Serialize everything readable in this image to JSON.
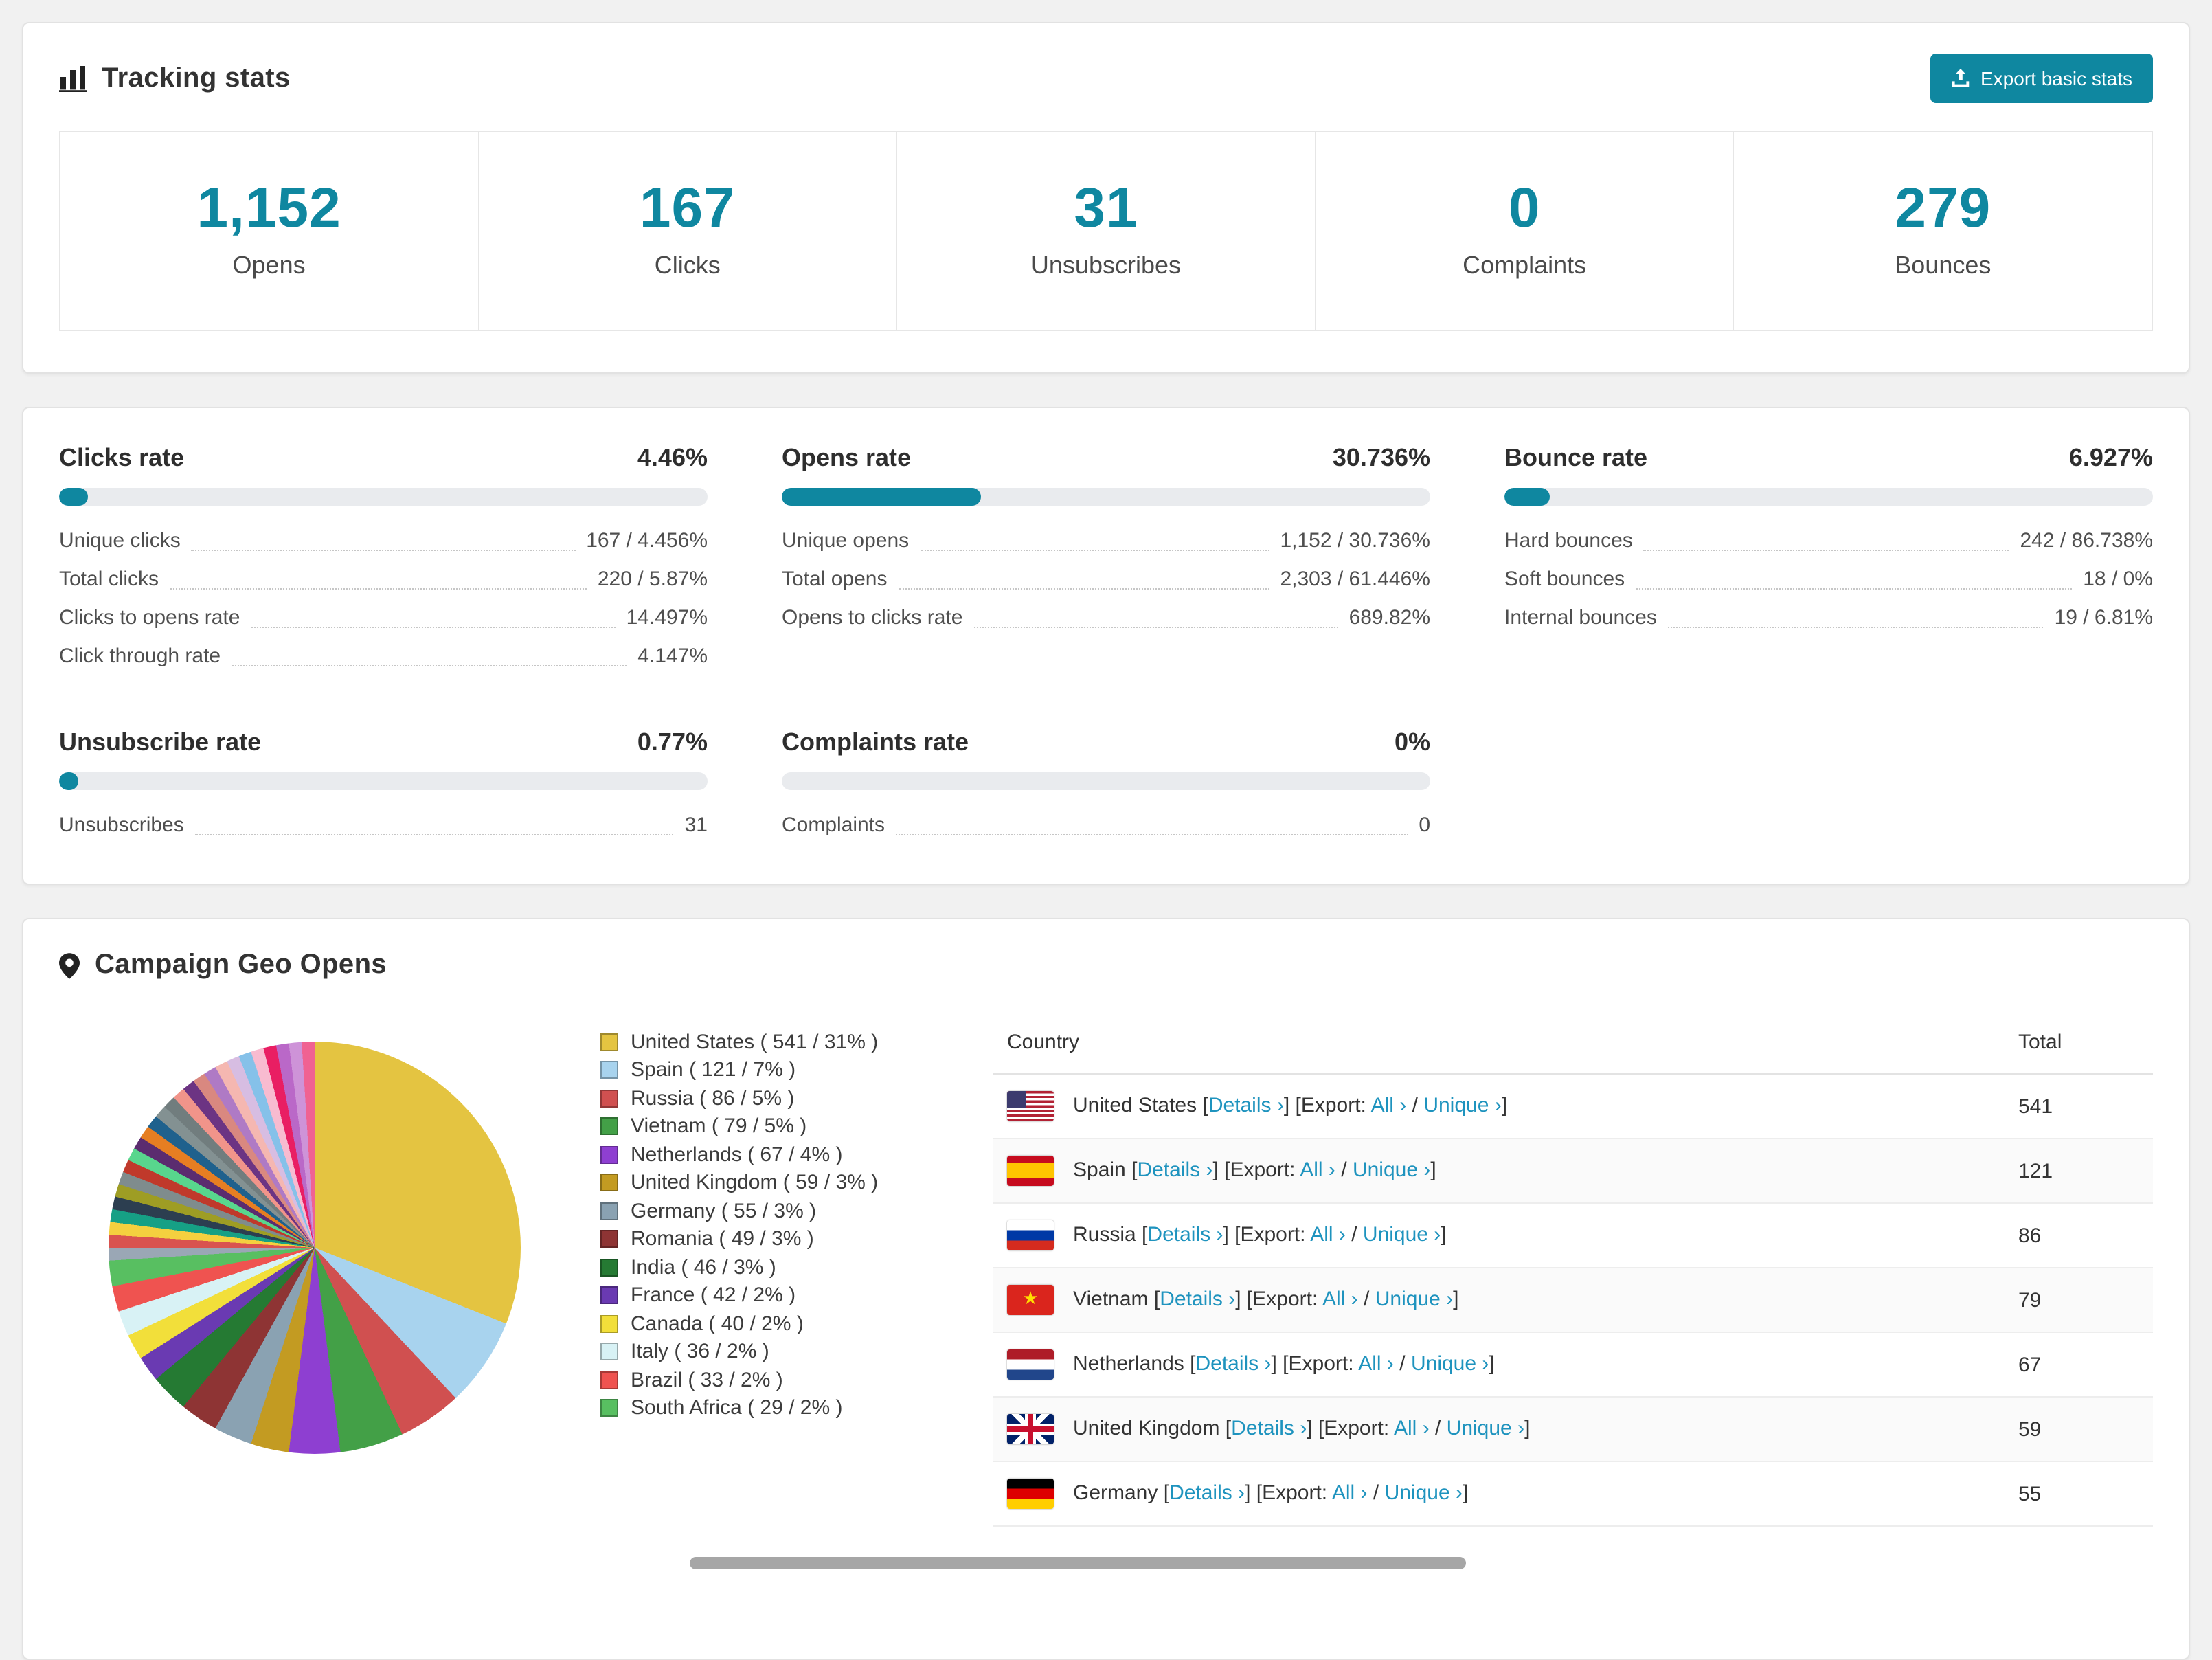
{
  "accent_color": "#0f87a0",
  "link_color": "#1e93be",
  "tracking": {
    "title": "Tracking stats",
    "export_button_label": "Export basic stats",
    "stats": [
      {
        "value": "1,152",
        "label": "Opens"
      },
      {
        "value": "167",
        "label": "Clicks"
      },
      {
        "value": "31",
        "label": "Unsubscribes"
      },
      {
        "value": "0",
        "label": "Complaints"
      },
      {
        "value": "279",
        "label": "Bounces"
      }
    ]
  },
  "rates": [
    {
      "title": "Clicks rate",
      "value": "4.46%",
      "percent": 4.46,
      "rows": [
        {
          "label": "Unique clicks",
          "value": "167 / 4.456%"
        },
        {
          "label": "Total clicks",
          "value": "220 / 5.87%"
        },
        {
          "label": "Clicks to opens rate",
          "value": "14.497%"
        },
        {
          "label": "Click through rate",
          "value": "4.147%"
        }
      ]
    },
    {
      "title": "Opens rate",
      "value": "30.736%",
      "percent": 30.736,
      "rows": [
        {
          "label": "Unique opens",
          "value": "1,152 / 30.736%"
        },
        {
          "label": "Total opens",
          "value": "2,303 / 61.446%"
        },
        {
          "label": "Opens to clicks rate",
          "value": "689.82%"
        }
      ]
    },
    {
      "title": "Bounce rate",
      "value": "6.927%",
      "percent": 6.927,
      "rows": [
        {
          "label": "Hard bounces",
          "value": "242 / 86.738%"
        },
        {
          "label": "Soft bounces",
          "value": "18 / 0%"
        },
        {
          "label": "Internal bounces",
          "value": "19 / 6.81%"
        }
      ]
    },
    {
      "title": "Unsubscribe rate",
      "value": "0.77%",
      "percent": 0.77,
      "rows": [
        {
          "label": "Unsubscribes",
          "value": "31"
        }
      ]
    },
    {
      "title": "Complaints rate",
      "value": "0%",
      "percent": 0,
      "rows": [
        {
          "label": "Complaints",
          "value": "0"
        }
      ]
    }
  ],
  "geo": {
    "title": "Campaign Geo Opens",
    "table": {
      "headers": [
        "Country",
        "Total"
      ],
      "details_label": "Details ›",
      "export_prefix": "[Export:",
      "all_label": "All ›",
      "unique_label": "Unique ›"
    },
    "countries": [
      {
        "name": "United States",
        "total": "541",
        "flag": "us"
      },
      {
        "name": "Spain",
        "total": "121",
        "flag": "es"
      },
      {
        "name": "Russia",
        "total": "86",
        "flag": "ru"
      },
      {
        "name": "Vietnam",
        "total": "79",
        "flag": "vn"
      },
      {
        "name": "Netherlands",
        "total": "67",
        "flag": "nl"
      },
      {
        "name": "United Kingdom",
        "total": "59",
        "flag": "gb"
      },
      {
        "name": "Germany",
        "total": "55",
        "flag": "de"
      }
    ],
    "chart_data": {
      "type": "pie",
      "title": "Campaign Geo Opens",
      "slices": [
        {
          "label": "United States",
          "count": 541,
          "percent": 31,
          "color": "#e4c441"
        },
        {
          "label": "Spain",
          "count": 121,
          "percent": 7,
          "color": "#a8d3ee"
        },
        {
          "label": "Russia",
          "count": 86,
          "percent": 5,
          "color": "#d05050"
        },
        {
          "label": "Vietnam",
          "count": 79,
          "percent": 5,
          "color": "#43a047"
        },
        {
          "label": "Netherlands",
          "count": 67,
          "percent": 4,
          "color": "#8e3fd1"
        },
        {
          "label": "United Kingdom",
          "count": 59,
          "percent": 3,
          "color": "#c39b22"
        },
        {
          "label": "Germany",
          "count": 55,
          "percent": 3,
          "color": "#8aa2b2"
        },
        {
          "label": "Romania",
          "count": 49,
          "percent": 3,
          "color": "#8e3434"
        },
        {
          "label": "India",
          "count": 46,
          "percent": 3,
          "color": "#257a33"
        },
        {
          "label": "France",
          "count": 42,
          "percent": 2,
          "color": "#6a3ab2"
        },
        {
          "label": "Canada",
          "count": 40,
          "percent": 2,
          "color": "#f2df3a"
        },
        {
          "label": "Italy",
          "count": 36,
          "percent": 2,
          "color": "#d8f2f5"
        },
        {
          "label": "Brazil",
          "count": 33,
          "percent": 2,
          "color": "#ef5350"
        },
        {
          "label": "South Africa",
          "count": 29,
          "percent": 2,
          "color": "#58bf61"
        }
      ],
      "other_slices_percent_total": 26,
      "other_slice_colors": [
        "#9aa7b5",
        "#d9534f",
        "#f4d03f",
        "#16a085",
        "#2c3e50",
        "#9e9d24",
        "#7f8c8d",
        "#c0392b",
        "#58d68d",
        "#5b2c6f",
        "#e67e22",
        "#1f618d",
        "#839192",
        "#717d7e",
        "#f1948a",
        "#6c3483",
        "#d98880",
        "#af7ac5",
        "#f5b7b1",
        "#d7bde2",
        "#85c1e9",
        "#f8bbd0",
        "#e91e63",
        "#ba68c8",
        "#ce93d8",
        "#f06292"
      ]
    }
  }
}
